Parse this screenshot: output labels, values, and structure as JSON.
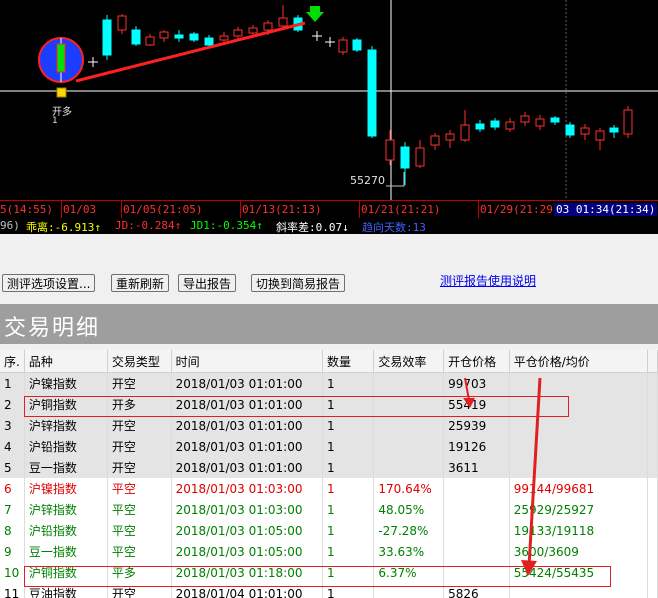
{
  "chart": {
    "price_label": "55270",
    "marker_label": "开多",
    "marker_sub": "1",
    "time_labels": [
      "5(14:55)",
      "01/03",
      "01/05(21:05)",
      "01/13(21:13)",
      "01/21(21:21)",
      "01/29(21:29)",
      "03 01:34(21:34)"
    ],
    "indicators": [
      {
        "text": "96)",
        "color": "#c0c0c0"
      },
      {
        "text": "乖离:-6.913↑",
        "color": "#ffff00"
      },
      {
        "text": "JD:-0.284↑",
        "color": "#ff3030"
      },
      {
        "text": "JD1:-0.354↑",
        "color": "#00ff00"
      },
      {
        "text": "斜率差:0.07↓",
        "color": "#ffffff"
      },
      {
        "text": "趋向天数:13",
        "color": "#4040ff"
      }
    ]
  },
  "toolbar": {
    "buttons": [
      "测评选项设置...",
      "重新刷新",
      "导出报告",
      "切换到简易报告"
    ],
    "help_link": "测评报告使用说明"
  },
  "section_title": "交易明细",
  "table": {
    "columns": [
      "序.",
      "品种",
      "交易类型",
      "时间",
      "数量",
      "交易效率",
      "开仓价格",
      "平仓价格/均价",
      ""
    ],
    "rows": [
      {
        "cells": [
          "1",
          "沪镍指数",
          "开空",
          "2018/01/03 01:01:00",
          "1",
          "",
          "99703",
          "",
          ""
        ],
        "color": "black"
      },
      {
        "cells": [
          "2",
          "沪铜指数",
          "开多",
          "2018/01/03 01:01:00",
          "1",
          "",
          "55419",
          "",
          ""
        ],
        "color": "black"
      },
      {
        "cells": [
          "3",
          "沪锌指数",
          "开空",
          "2018/01/03 01:01:00",
          "1",
          "",
          "25939",
          "",
          ""
        ],
        "color": "black"
      },
      {
        "cells": [
          "4",
          "沪铅指数",
          "开空",
          "2018/01/03 01:01:00",
          "1",
          "",
          "19126",
          "",
          ""
        ],
        "color": "black"
      },
      {
        "cells": [
          "5",
          "豆一指数",
          "开空",
          "2018/01/03 01:01:00",
          "1",
          "",
          "3611",
          "",
          ""
        ],
        "color": "black"
      },
      {
        "cells": [
          "6",
          "沪镍指数",
          "平空",
          "2018/01/03 01:03:00",
          "1",
          "170.64%",
          "",
          "99144/99681",
          ""
        ],
        "color": "red"
      },
      {
        "cells": [
          "7",
          "沪锌指数",
          "平空",
          "2018/01/03 01:03:00",
          "1",
          "48.05%",
          "",
          "25929/25927",
          ""
        ],
        "color": "green"
      },
      {
        "cells": [
          "8",
          "沪铅指数",
          "平空",
          "2018/01/03 01:05:00",
          "1",
          "-27.28%",
          "",
          "19133/19118",
          ""
        ],
        "color": "green"
      },
      {
        "cells": [
          "9",
          "豆一指数",
          "平空",
          "2018/01/03 01:05:00",
          "1",
          "33.63%",
          "",
          "3600/3609",
          ""
        ],
        "color": "green"
      },
      {
        "cells": [
          "10",
          "沪铜指数",
          "平多",
          "2018/01/03 01:18:00",
          "1",
          "6.37%",
          "",
          "55424/55435",
          ""
        ],
        "color": "green"
      },
      {
        "cells": [
          "11",
          "豆油指数",
          "开空",
          "2018/01/04 01:01:00",
          "1",
          "",
          "5826",
          "",
          ""
        ],
        "color": "black"
      }
    ]
  }
}
